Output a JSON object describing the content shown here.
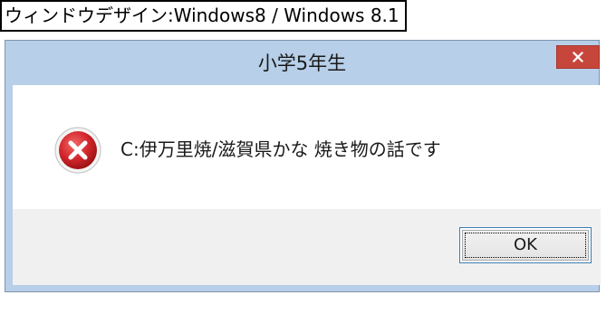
{
  "caption": {
    "text": "ウィンドウデザイン:Windows8 / Windows 8.1"
  },
  "dialog": {
    "title": "小学5年生",
    "close_button": {
      "label": "×",
      "icon": "close-icon"
    },
    "message": "C:伊万里焼/滋賀県かな  焼き物の話です",
    "icon": "error-icon",
    "ok_button": {
      "label": "OK"
    }
  },
  "colors": {
    "frame": "#b7cfe8",
    "close_button": "#c7463b",
    "error_icon": "#c8242a",
    "footer": "#f0f0f0",
    "ok_focus_border": "#3c7fb1"
  }
}
